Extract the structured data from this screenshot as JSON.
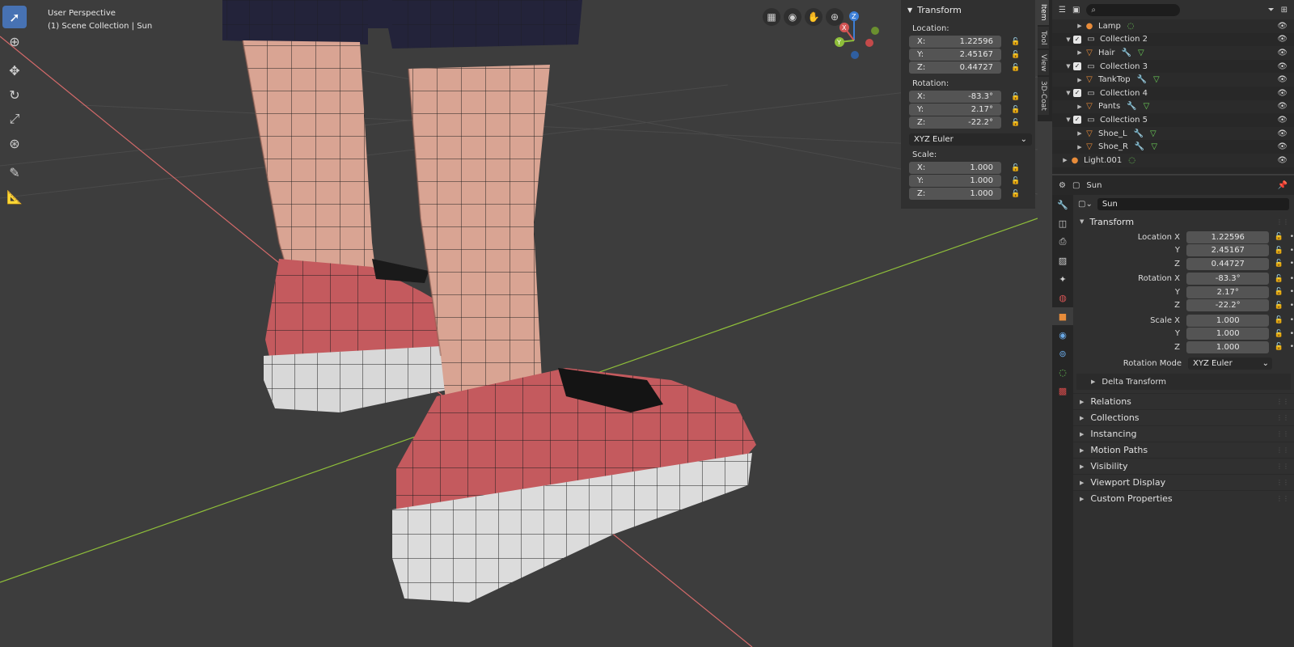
{
  "viewport": {
    "perspective": "User Perspective",
    "collection": "(1) Scene Collection | Sun"
  },
  "npanel": {
    "title": "Transform",
    "location_label": "Location:",
    "rotation_label": "Rotation:",
    "scale_label": "Scale:",
    "location": [
      {
        "axis": "X:",
        "value": "1.22596"
      },
      {
        "axis": "Y:",
        "value": "2.45167"
      },
      {
        "axis": "Z:",
        "value": "0.44727"
      }
    ],
    "rotation": [
      {
        "axis": "X:",
        "value": "-83.3°"
      },
      {
        "axis": "Y:",
        "value": "2.17°"
      },
      {
        "axis": "Z:",
        "value": "-22.2°"
      }
    ],
    "scale": [
      {
        "axis": "X:",
        "value": "1.000"
      },
      {
        "axis": "Y:",
        "value": "1.000"
      },
      {
        "axis": "Z:",
        "value": "1.000"
      }
    ],
    "rotation_mode": "XYZ Euler",
    "tabs": [
      "Item",
      "Tool",
      "View",
      "3D-Coat"
    ]
  },
  "outliner": {
    "rows": [
      {
        "label": "Lamp",
        "indent": 1,
        "icon": "lamp-icon"
      },
      {
        "label": "Collection 2",
        "indent": 0,
        "icon": "collection-icon"
      },
      {
        "label": "Hair",
        "indent": 1,
        "icon": "mesh-icon"
      },
      {
        "label": "Collection 3",
        "indent": 0,
        "icon": "collection-icon"
      },
      {
        "label": "TankTop",
        "indent": 1,
        "icon": "mesh-icon"
      },
      {
        "label": "Collection 4",
        "indent": 0,
        "icon": "collection-icon"
      },
      {
        "label": "Pants",
        "indent": 1,
        "icon": "mesh-icon"
      },
      {
        "label": "Collection 5",
        "indent": 0,
        "icon": "collection-icon"
      },
      {
        "label": "Shoe_L",
        "indent": 1,
        "icon": "mesh-icon"
      },
      {
        "label": "Shoe_R",
        "indent": 1,
        "icon": "mesh-icon"
      },
      {
        "label": "Light.001",
        "indent": -1,
        "icon": "light-icon"
      }
    ]
  },
  "properties": {
    "object_name_header": "Sun",
    "object_name": "Sun",
    "transform_title": "Transform",
    "location_x_label": "Location X",
    "rotation_x_label": "Rotation X",
    "scale_x_label": "Scale X",
    "y_label": "Y",
    "z_label": "Z",
    "location": [
      "1.22596",
      "2.45167",
      "0.44727"
    ],
    "rotation": [
      "-83.3°",
      "2.17°",
      "-22.2°"
    ],
    "scale": [
      "1.000",
      "1.000",
      "1.000"
    ],
    "rotation_mode_label": "Rotation Mode",
    "rotation_mode": "XYZ Euler",
    "delta_transform": "Delta Transform",
    "sections": [
      "Relations",
      "Collections",
      "Instancing",
      "Motion Paths",
      "Visibility",
      "Viewport Display",
      "Custom Properties"
    ]
  },
  "colors": {
    "accent": "#4772b3",
    "viewport_bg": "#3d3d3d",
    "shoe": "#c45a5e",
    "skin": "#d9a493",
    "x_axis": "#e06a6a",
    "y_axis": "#8fbf3a"
  }
}
